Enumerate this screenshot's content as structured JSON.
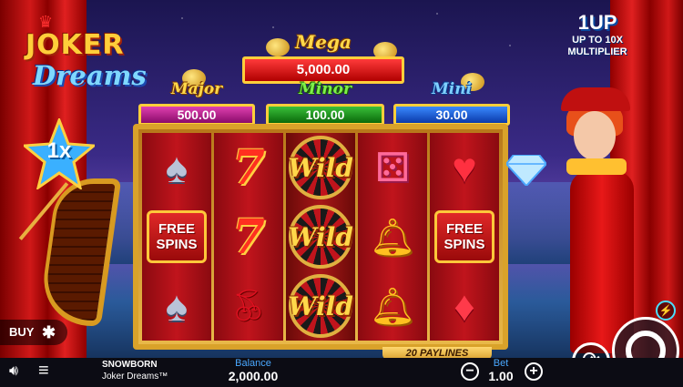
{
  "logo": {
    "line1": "JOKER",
    "line2": "Dreams"
  },
  "multiplier": {
    "value": "1x"
  },
  "jackpots": {
    "mega": {
      "title": "Mega",
      "amount": "5,000.00"
    },
    "major": {
      "title": "Major",
      "amount": "500.00"
    },
    "minor": {
      "title": "Minor",
      "amount": "100.00"
    },
    "mini": {
      "title": "Mini",
      "amount": "30.00"
    }
  },
  "promo": {
    "title": "1UP",
    "line1": "UP TO 10X",
    "line2": "MULTIPLIER"
  },
  "reels": [
    [
      "spade",
      "free_spins",
      "spade"
    ],
    [
      "seven",
      "seven",
      "cherry"
    ],
    [
      "wild",
      "wild",
      "wild"
    ],
    [
      "dice",
      "bell",
      "bell"
    ],
    [
      "heart",
      "free_spins",
      "diamond"
    ]
  ],
  "symbols": {
    "wild": "Wild",
    "free_line1": "FREE",
    "free_line2": "SPINS"
  },
  "paylines": "20 PAYLINES",
  "buy": {
    "label": "BUY"
  },
  "footer": {
    "brand": "SNOWBORN",
    "game_name": "Joker Dreams™",
    "balance_label": "Balance",
    "balance_value": "2,000.00",
    "bet_label": "Bet",
    "bet_value": "1.00"
  },
  "colors": {
    "mega": "#d01010",
    "major": "#c0208a",
    "minor": "#1a9a1a",
    "mini": "#1a5ad0",
    "accent": "#ffd84a"
  }
}
